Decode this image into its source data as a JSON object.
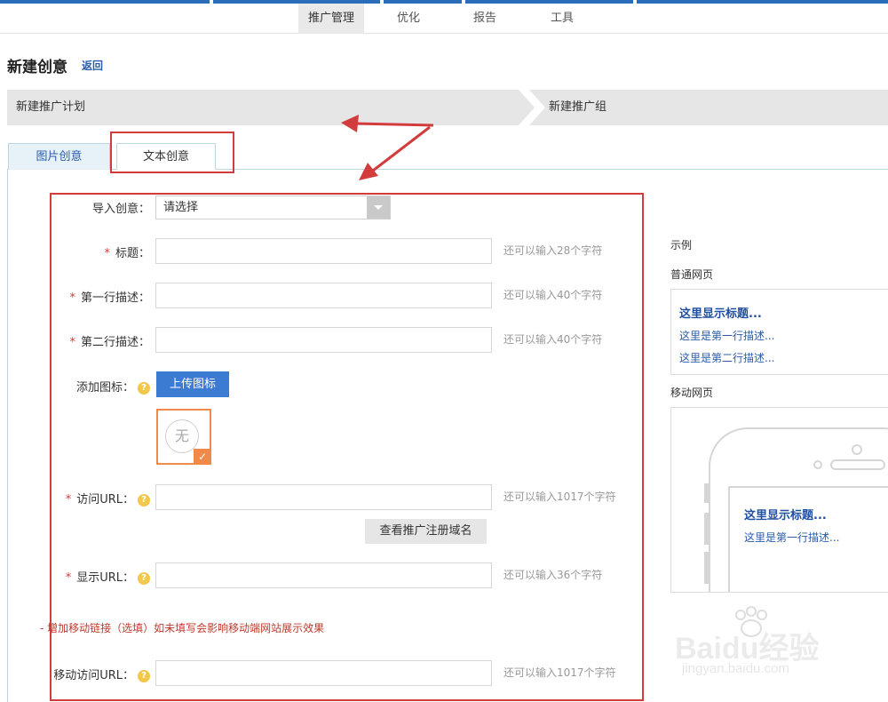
{
  "nav": {
    "items": [
      {
        "label": "推广管理",
        "active": true
      },
      {
        "label": "优化",
        "active": false
      },
      {
        "label": "报告",
        "active": false
      },
      {
        "label": "工具",
        "active": false
      }
    ]
  },
  "header": {
    "title": "新建创意",
    "back_label": "返回"
  },
  "steps": [
    "新建推广计划",
    "新建推广组"
  ],
  "tabs": [
    {
      "label": "图片创意",
      "active": false
    },
    {
      "label": "文本创意",
      "active": true
    }
  ],
  "form": {
    "import": {
      "label": "导入创意：",
      "value": "请选择"
    },
    "title": {
      "label": "标题：",
      "value": "",
      "hint": "还可以输入28个字符"
    },
    "desc1": {
      "label": "第一行描述：",
      "value": "",
      "hint": "还可以输入40个字符"
    },
    "desc2": {
      "label": "第二行描述：",
      "value": "",
      "hint": "还可以输入40个字符"
    },
    "icon": {
      "label": "添加图标：",
      "upload_label": "上传图标",
      "none_label": "无"
    },
    "visit_url": {
      "label": "访问URL：",
      "value": "",
      "hint": "还可以输入1017个字符"
    },
    "domain_button": "查看推广注册域名",
    "display_url": {
      "label": "显示URL：",
      "value": "",
      "hint": "还可以输入36个字符"
    },
    "mobile_toggle": "- 增加移动链接（选填）如未填写会影响移动端网站展示效果",
    "mobile_url": {
      "label": "移动访问URL：",
      "value": "",
      "hint": "还可以输入1017个字符"
    },
    "required_mark": "*",
    "help_mark": "?"
  },
  "example": {
    "title": "示例",
    "pc_label": "普通网页",
    "pc_preview": {
      "title": "这里显示标题...",
      "line1": "这里是第一行描述...",
      "line2": "这里是第二行描述..."
    },
    "mobile_label": "移动网页",
    "mobile_preview": {
      "title": "这里显示标题...",
      "line1": "这里是第一行描述..."
    }
  },
  "watermark": {
    "brand": "Baidu经验",
    "url": "jingyan.baidu.com"
  },
  "colors": {
    "accent": "#2a6ebb",
    "highlight": "#d23c3c",
    "upload_button": "#3b7bd1",
    "link": "#2a5caa",
    "icon_selected": "#f08a4b"
  },
  "icons": [
    "dropdown-arrow-icon",
    "help-icon",
    "check-icon",
    "none-icon",
    "arrow-annotation-icon"
  ]
}
